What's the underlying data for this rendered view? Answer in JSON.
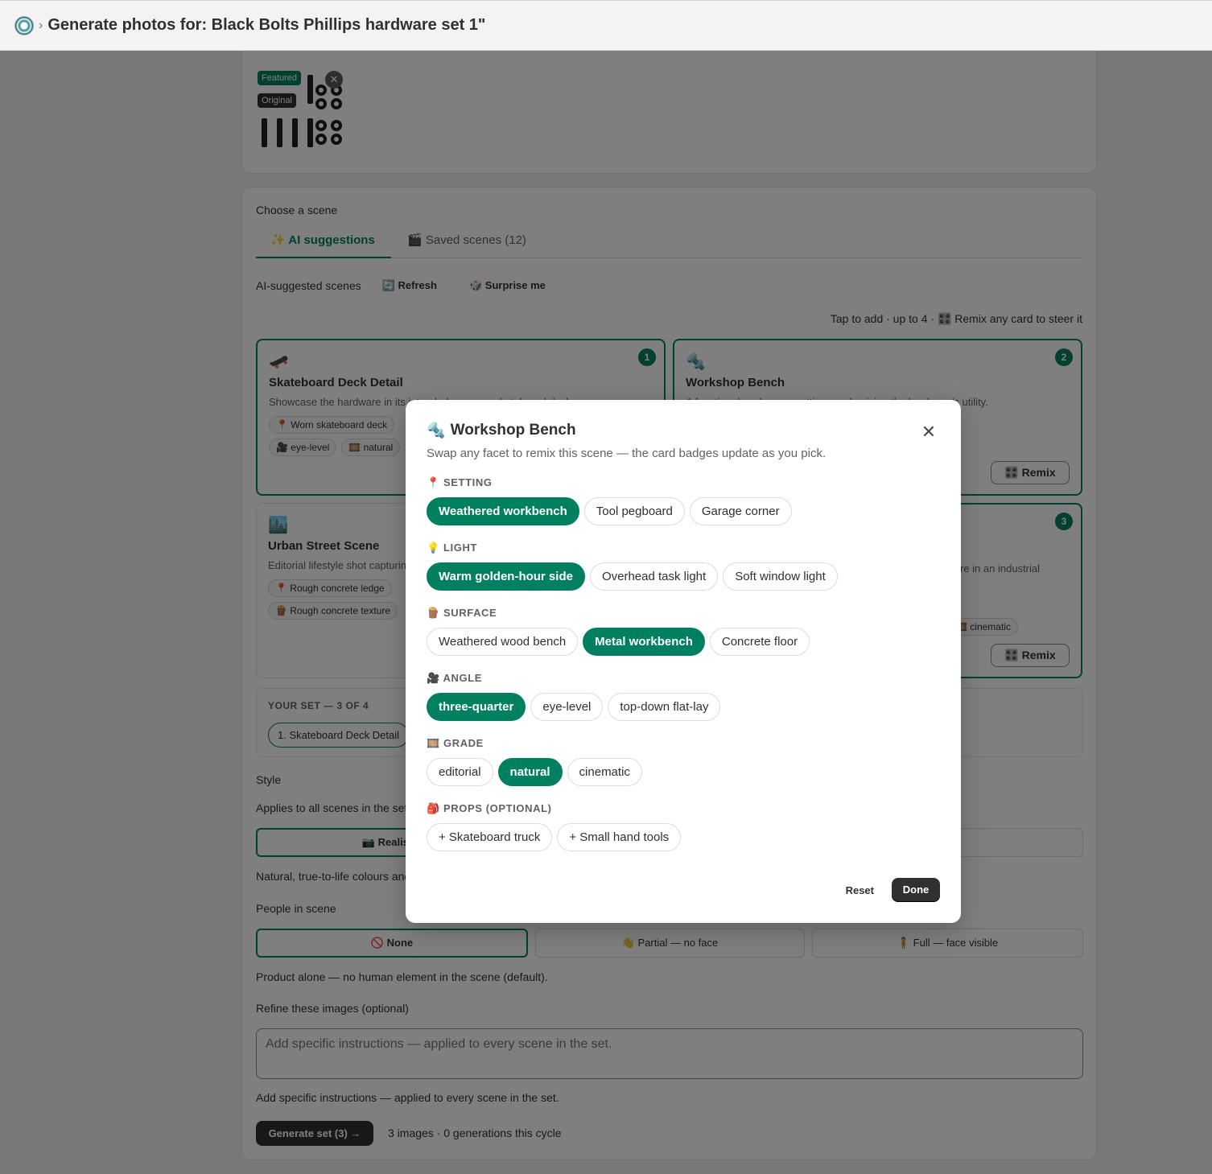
{
  "header": {
    "title": "Generate photos for: Black Bolts Phillips hardware set 1\"",
    "logo_icon": "app-logo-icon"
  },
  "image_card": {
    "featured_badge": "Featured",
    "original_badge": "Original",
    "remove_label": "✕"
  },
  "scene_section": {
    "label": "Choose a scene",
    "tabs": [
      {
        "label": "✨ AI suggestions"
      },
      {
        "label": "🎬 Saved scenes (12)"
      }
    ],
    "suggested_label": "AI-suggested scenes",
    "refresh_label": "🔄 Refresh",
    "surprise_label": "🎲 Surprise me",
    "hint": "Tap to add · up to 4 · 🎛️ Remix any card to steer it",
    "remix_label": "🎛️ Remix",
    "cards": [
      {
        "icon": "🛹",
        "title": "Skateboard Deck Detail",
        "number": "1",
        "desc": "Showcase the hardware in its intended use on a skateboard deck.",
        "chips": [
          "📍 Worn skateboard deck",
          "🎥 eye-level",
          "🎞️ natural"
        ]
      },
      {
        "icon": "🔩",
        "title": "Workshop Bench",
        "number": "2",
        "desc": "A functional workspace setting emphasizing the hardware's utility."
      },
      {
        "icon": "🏙️",
        "title": "Urban Street Scene",
        "desc": "Editorial lifestyle shot capturing the hardware in an urban setting.",
        "chips": [
          "📍 Rough concrete ledge",
          "🪵 Rough concrete texture"
        ]
      },
      {
        "number": "3",
        "desc": "re in an industrial",
        "chips": [
          "🎞️ cinematic"
        ]
      }
    ]
  },
  "your_set": {
    "label": "YOUR SET — 3 OF 4",
    "items": [
      "1. Skateboard Deck Detail"
    ]
  },
  "style": {
    "label": "Style",
    "sub": "Applies to all scenes in the set.",
    "options": [
      "📷 Realistic",
      "atic"
    ],
    "desc": "Natural, true-to-life colours and lighting."
  },
  "people": {
    "label": "People in scene",
    "options": [
      "🚫 None",
      "👋 Partial — no face",
      "🧍 Full — face visible"
    ],
    "desc": "Product alone — no human element in the scene (default)."
  },
  "refine": {
    "label": "Refine these images (optional)",
    "placeholder": "Add specific instructions — applied to every scene in the set.",
    "help": "Add specific instructions — applied to every scene in the set."
  },
  "generate": {
    "button": "Generate set (3) →",
    "info": "3 images · 0 generations this cycle"
  },
  "modal": {
    "icon": "🔩",
    "title": "Workshop Bench",
    "subtitle": "Swap any facet to remix this scene — the card badges update as you pick.",
    "close_label": "✕",
    "facets": [
      {
        "label": "📍 SETTING",
        "options": [
          "Weathered workbench",
          "Tool pegboard",
          "Garage corner"
        ],
        "selected": 0
      },
      {
        "label": "💡 LIGHT",
        "options": [
          "Warm golden-hour side",
          "Overhead task light",
          "Soft window light"
        ],
        "selected": 0
      },
      {
        "label": "🪵 SURFACE",
        "options": [
          "Weathered wood bench",
          "Metal workbench",
          "Concrete floor"
        ],
        "selected": 1
      },
      {
        "label": "🎥 ANGLE",
        "options": [
          "three-quarter",
          "eye-level",
          "top-down flat-lay"
        ],
        "selected": 0
      },
      {
        "label": "🎞️ GRADE",
        "options": [
          "editorial",
          "natural",
          "cinematic"
        ],
        "selected": 1
      },
      {
        "label": "🎒 PROPS (OPTIONAL)",
        "options": [
          "+ Skateboard truck",
          "+ Small hand tools"
        ],
        "selected": -1
      }
    ],
    "reset_label": "Reset",
    "done_label": "Done"
  },
  "colors": {
    "accent": "#008060",
    "dark": "#303030"
  }
}
